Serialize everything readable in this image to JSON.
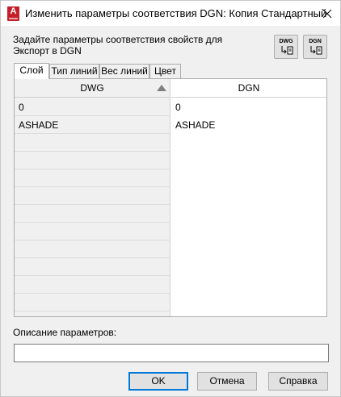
{
  "window": {
    "title": "Изменить параметры соответствия DGN: Копия Стандартный",
    "app_icon_letter": "A"
  },
  "description": "Задайте параметры соответствия свойств для Экспорт в DGN",
  "icon_buttons": {
    "dwg_label": "DWG",
    "dgn_label": "DGN"
  },
  "tabs": [
    "Слой",
    "Тип линий",
    "Вес линий",
    "Цвет"
  ],
  "active_tab": "Слой",
  "table": {
    "columns": [
      "DWG",
      "DGN"
    ],
    "sort_column": "DWG",
    "rows": [
      [
        "0",
        "0"
      ],
      [
        "ASHADE",
        "ASHADE"
      ]
    ]
  },
  "params": {
    "label": "Описание параметров:",
    "value": ""
  },
  "buttons": {
    "ok": "OK",
    "cancel": "Отмена",
    "help": "Справка"
  }
}
